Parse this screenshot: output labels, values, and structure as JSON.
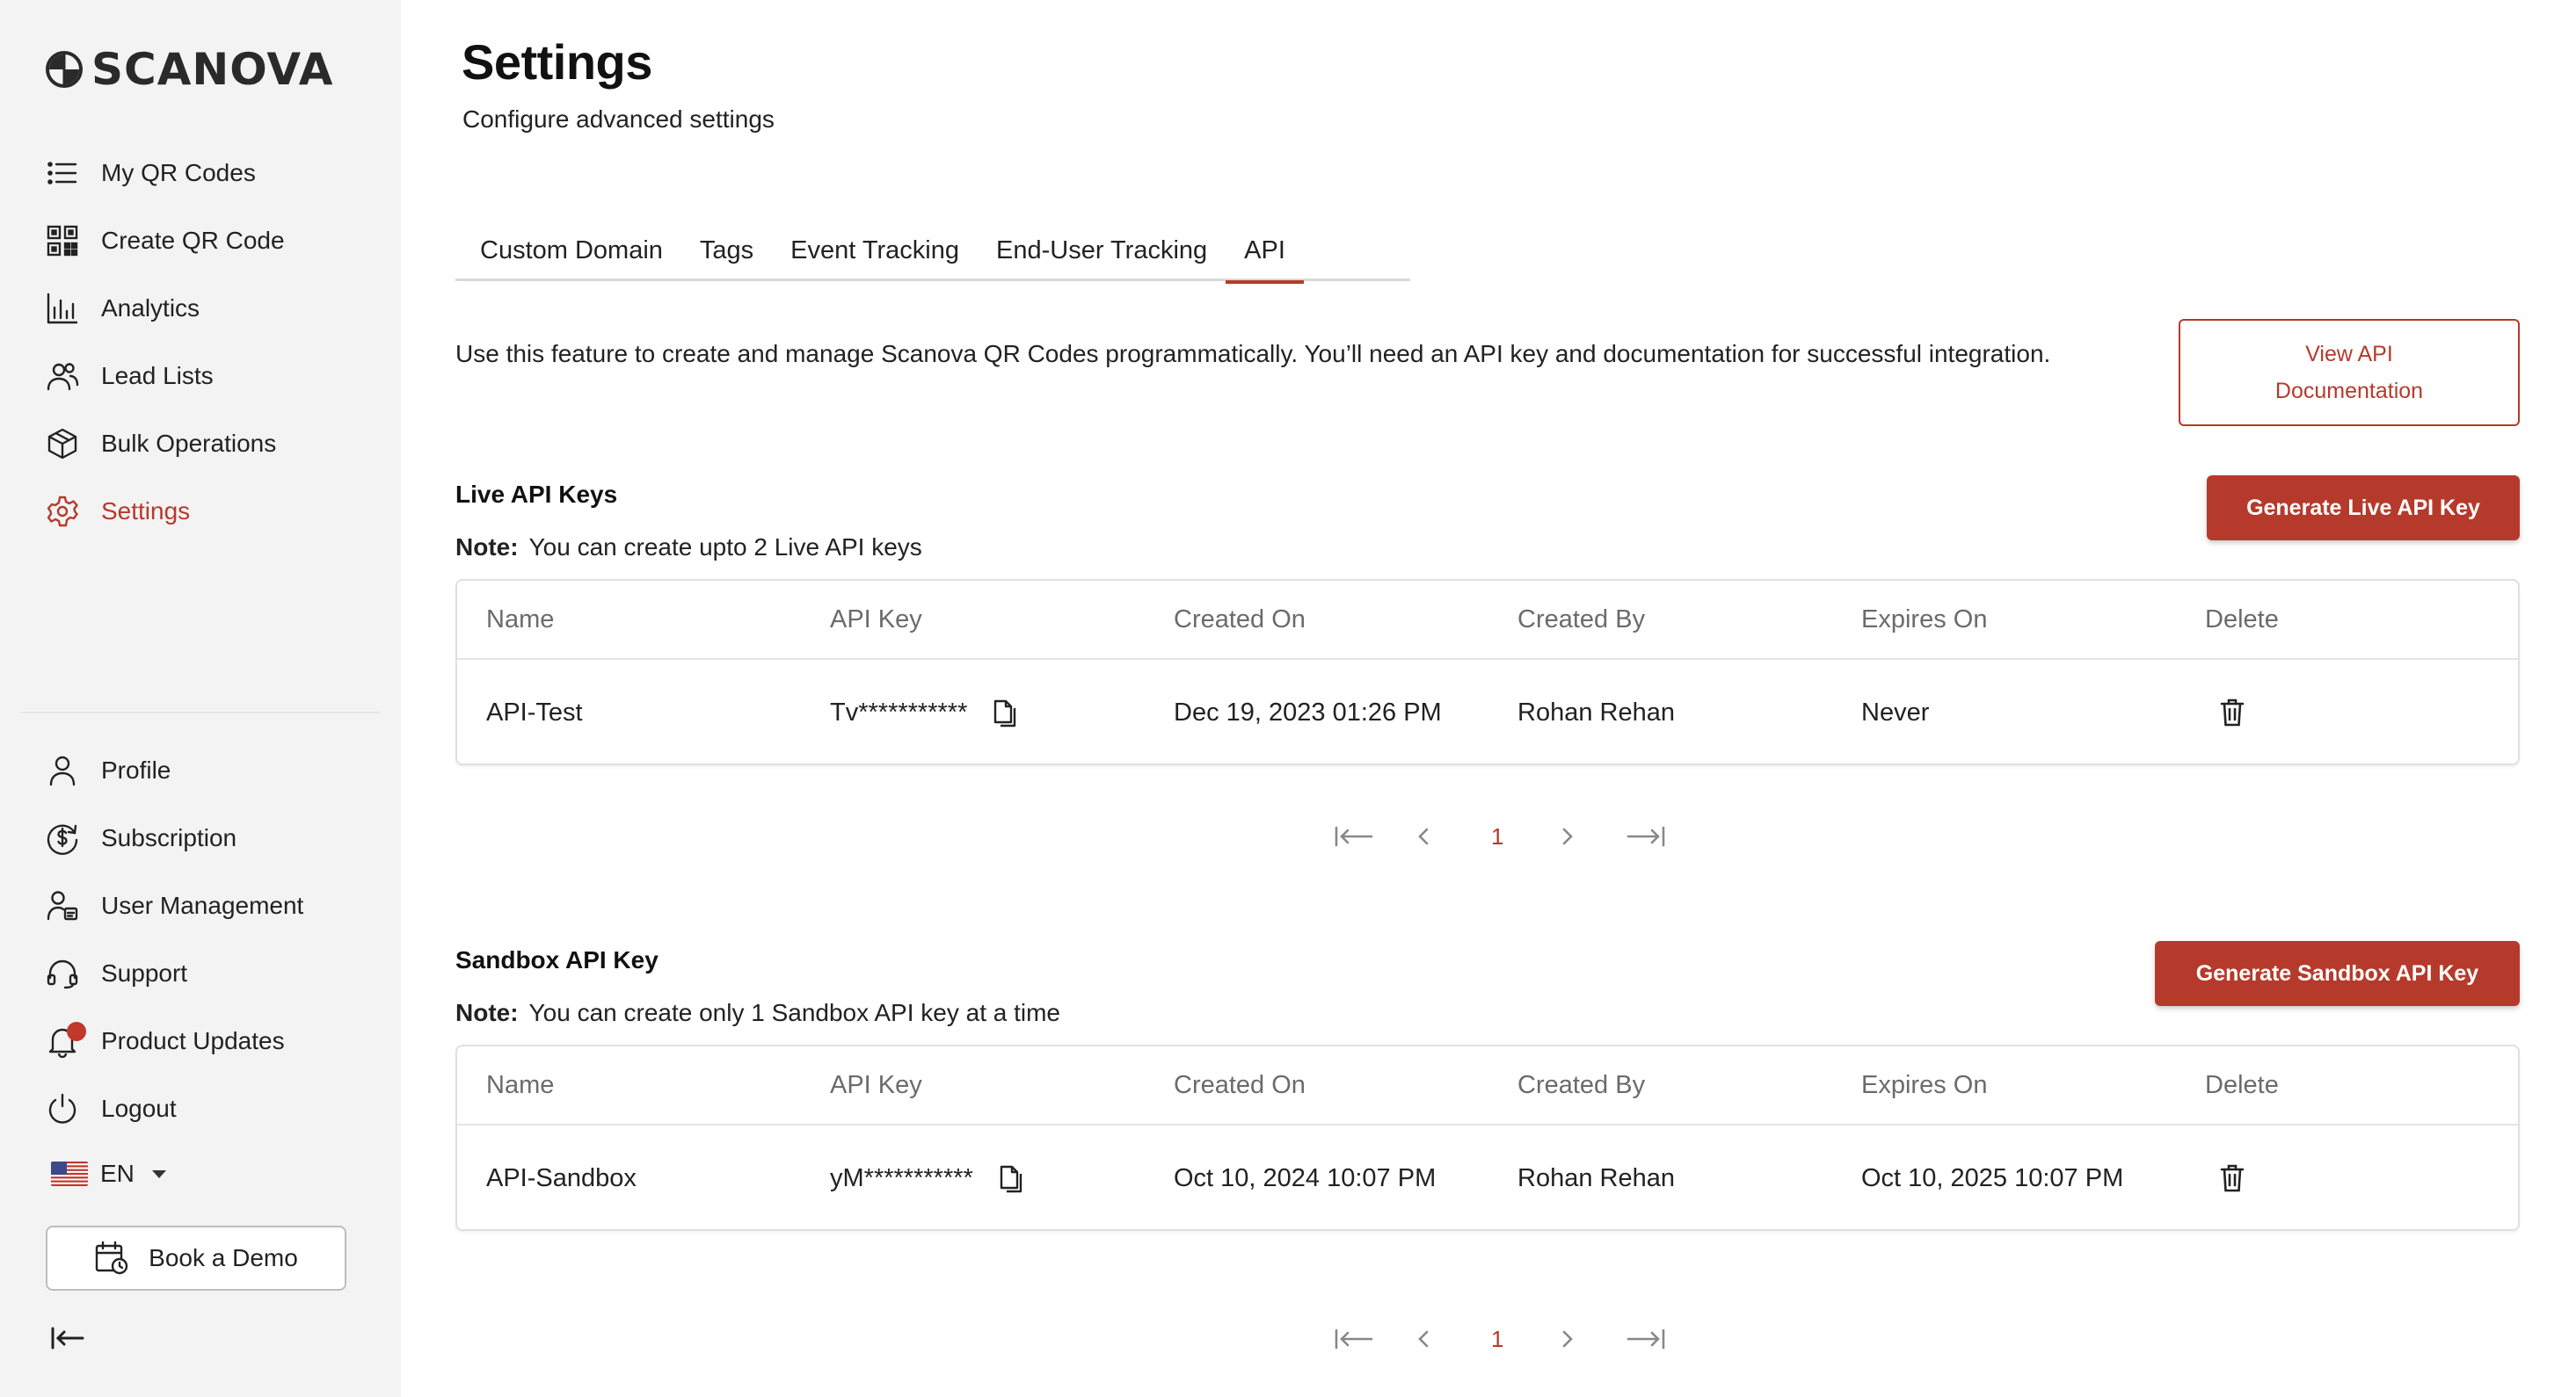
{
  "brand": {
    "name": "SCANOVA",
    "accent": "#b63a2b"
  },
  "sidebar": {
    "top_items": [
      {
        "label": "My QR Codes",
        "icon": "list-icon"
      },
      {
        "label": "Create QR Code",
        "icon": "qr-code-icon"
      },
      {
        "label": "Analytics",
        "icon": "bar-chart-icon"
      },
      {
        "label": "Lead Lists",
        "icon": "users-icon"
      },
      {
        "label": "Bulk Operations",
        "icon": "box-icon"
      },
      {
        "label": "Settings",
        "icon": "gear-icon",
        "active": true
      }
    ],
    "bottom_items": [
      {
        "label": "Profile",
        "icon": "user-icon"
      },
      {
        "label": "Subscription",
        "icon": "dollar-refresh-icon"
      },
      {
        "label": "User Management",
        "icon": "user-management-icon"
      },
      {
        "label": "Support",
        "icon": "headset-icon"
      },
      {
        "label": "Product Updates",
        "icon": "bell-icon",
        "has_notification": true
      },
      {
        "label": "Logout",
        "icon": "power-icon"
      }
    ],
    "language": "EN",
    "demo_label": "Book a Demo"
  },
  "page": {
    "title": "Settings",
    "subtitle": "Configure advanced settings"
  },
  "tabs": [
    {
      "label": "Custom Domain"
    },
    {
      "label": "Tags"
    },
    {
      "label": "Event Tracking"
    },
    {
      "label": "End-User Tracking"
    },
    {
      "label": "API",
      "active": true
    }
  ],
  "api": {
    "description": "Use this feature to create and manage Scanova QR Codes programmatically. You’ll need an API key and documentation for successful integration.",
    "docs_button": "View API Documentation",
    "columns": [
      "Name",
      "API Key",
      "Created On",
      "Created By",
      "Expires On",
      "Delete"
    ],
    "live": {
      "title": "Live API Keys",
      "note_label": "Note:",
      "note_text": "You can create upto 2 Live API keys",
      "button": "Generate Live API Key",
      "rows": [
        {
          "name": "API-Test",
          "key": "Tv***********",
          "created_on": "Dec 19, 2023 01:26 PM",
          "created_by": "Rohan Rehan",
          "expires_on": "Never"
        }
      ],
      "page": "1"
    },
    "sandbox": {
      "title": "Sandbox API Key",
      "note_label": "Note:",
      "note_text": "You can create only 1 Sandbox API key at a time",
      "button": "Generate Sandbox API Key",
      "rows": [
        {
          "name": "API-Sandbox",
          "key": "yM***********",
          "created_on": "Oct 10, 2024 10:07 PM",
          "created_by": "Rohan Rehan",
          "expires_on": "Oct 10, 2025 10:07 PM"
        }
      ],
      "page": "1"
    }
  }
}
